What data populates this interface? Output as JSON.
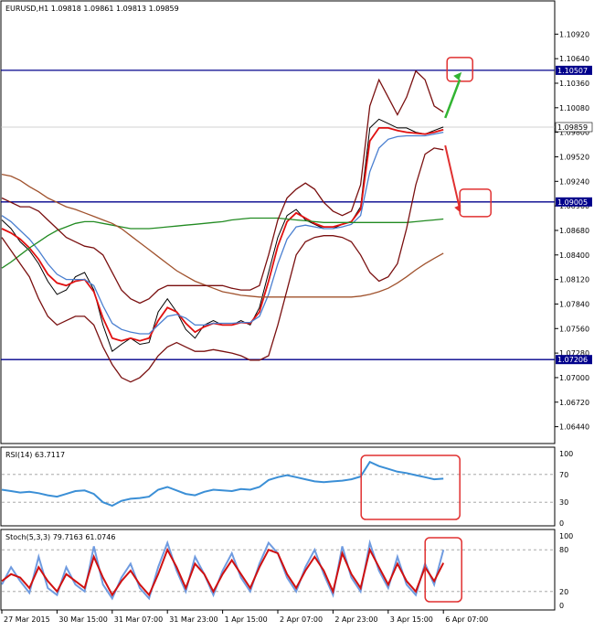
{
  "chart_data": [
    {
      "type": "line",
      "panel": "main",
      "header": "EURUSD,H1  1.09818 1.09861 1.09813 1.09859",
      "ylim": [
        1.063,
        1.1108
      ],
      "y_ticks": [
        "1.10920",
        "1.10640",
        "1.10360",
        "1.10080",
        "1.09800",
        "1.09520",
        "1.09240",
        "1.08960",
        "1.08680",
        "1.08400",
        "1.08120",
        "1.07840",
        "1.07560",
        "1.07280",
        "1.07000",
        "1.06720",
        "1.06440"
      ],
      "levels": [
        {
          "value": 1.10507,
          "label": "1.10507",
          "color": "#00008b"
        },
        {
          "value": 1.09005,
          "label": "1.09005",
          "color": "#00008b"
        },
        {
          "value": 1.07206,
          "label": "1.07206",
          "color": "#00008b"
        }
      ],
      "current_price": {
        "value": 1.09859,
        "label": "1.09859"
      },
      "x_points": [
        0,
        10,
        20,
        30,
        40,
        50,
        60,
        70,
        80,
        90,
        100,
        110,
        120,
        130,
        140,
        150,
        160,
        170,
        180,
        190,
        200,
        210,
        220,
        230,
        240,
        250,
        260,
        270,
        280,
        290,
        300,
        310,
        320,
        330,
        340,
        350,
        360,
        370,
        380,
        390,
        400,
        410,
        420,
        430,
        440,
        450,
        460,
        470,
        480
      ],
      "close": [
        1.088,
        1.087,
        1.0855,
        1.0845,
        1.083,
        1.081,
        1.0795,
        1.08,
        1.0815,
        1.082,
        1.08,
        1.076,
        1.073,
        1.0738,
        1.0745,
        1.0738,
        1.074,
        1.0775,
        1.079,
        1.0775,
        1.0755,
        1.0745,
        1.076,
        1.0765,
        1.076,
        1.076,
        1.0765,
        1.076,
        1.078,
        1.082,
        1.086,
        1.0885,
        1.0892,
        1.088,
        1.0875,
        1.087,
        1.087,
        1.0875,
        1.0878,
        1.0895,
        1.0985,
        1.0995,
        1.099,
        1.0985,
        1.0985,
        1.098,
        1.0978,
        1.0982,
        1.0986
      ],
      "series": [
        {
          "key": "ma_fast",
          "color": "#e01010",
          "values": [
            1.087,
            1.0865,
            1.0858,
            1.0848,
            1.0835,
            1.0818,
            1.0808,
            1.0805,
            1.081,
            1.0812,
            1.0798,
            1.0768,
            1.0745,
            1.0742,
            1.0745,
            1.0742,
            1.0745,
            1.0765,
            1.078,
            1.0775,
            1.0762,
            1.0752,
            1.0758,
            1.0762,
            1.076,
            1.076,
            1.0763,
            1.0762,
            1.0775,
            1.081,
            1.085,
            1.0878,
            1.0888,
            1.0882,
            1.0876,
            1.0872,
            1.0872,
            1.0875,
            1.0878,
            1.0892,
            1.097,
            1.0985,
            1.0985,
            1.0982,
            1.098,
            1.0979,
            1.0978,
            1.098,
            1.0983
          ]
        },
        {
          "key": "ma_mid",
          "color": "#4a7fd0",
          "values": [
            1.0885,
            1.0878,
            1.0868,
            1.0858,
            1.0845,
            1.083,
            1.0818,
            1.0812,
            1.0812,
            1.0812,
            1.0805,
            1.0782,
            1.0762,
            1.0755,
            1.0752,
            1.075,
            1.075,
            1.076,
            1.077,
            1.0772,
            1.0768,
            1.076,
            1.076,
            1.0762,
            1.0762,
            1.0762,
            1.0763,
            1.0763,
            1.077,
            1.0795,
            1.083,
            1.0858,
            1.0872,
            1.0874,
            1.0872,
            1.087,
            1.087,
            1.0872,
            1.0875,
            1.0885,
            1.0935,
            1.0962,
            1.0972,
            1.0975,
            1.0976,
            1.0976,
            1.0976,
            1.0978,
            1.098
          ]
        },
        {
          "key": "ma_200",
          "color": "#228b22",
          "values": [
            1.0825,
            1.0832,
            1.084,
            1.0848,
            1.0855,
            1.0862,
            1.0868,
            1.0872,
            1.0876,
            1.0878,
            1.0878,
            1.0876,
            1.0874,
            1.0872,
            1.087,
            1.087,
            1.087,
            1.0871,
            1.0872,
            1.0873,
            1.0874,
            1.0875,
            1.0876,
            1.0877,
            1.0878,
            1.088,
            1.0881,
            1.0882,
            1.0882,
            1.0882,
            1.0882,
            1.0881,
            1.088,
            1.0879,
            1.0878,
            1.0877,
            1.0877,
            1.0877,
            1.0877,
            1.0877,
            1.0877,
            1.0877,
            1.0877,
            1.0877,
            1.0877,
            1.0878,
            1.0879,
            1.088,
            1.0881
          ]
        },
        {
          "key": "ma_100",
          "color": "#a0522d",
          "values": [
            1.0932,
            1.093,
            1.0925,
            1.0918,
            1.0912,
            1.0905,
            1.09,
            1.0895,
            1.0892,
            1.0888,
            1.0884,
            1.088,
            1.0876,
            1.087,
            1.0862,
            1.0854,
            1.0846,
            1.0838,
            1.083,
            1.0822,
            1.0816,
            1.081,
            1.0806,
            1.0802,
            1.0798,
            1.0796,
            1.0794,
            1.0793,
            1.0792,
            1.0792,
            1.0792,
            1.0792,
            1.0792,
            1.0792,
            1.0792,
            1.0792,
            1.0792,
            1.0792,
            1.0792,
            1.0793,
            1.0795,
            1.0798,
            1.0802,
            1.0808,
            1.0815,
            1.0823,
            1.083,
            1.0836,
            1.0842
          ]
        },
        {
          "key": "bb_upper",
          "color": "#7a1010",
          "values": [
            1.0905,
            1.09,
            1.0895,
            1.0895,
            1.089,
            1.088,
            1.087,
            1.086,
            1.0855,
            1.085,
            1.0848,
            1.084,
            1.082,
            1.08,
            1.079,
            1.0785,
            1.079,
            1.08,
            1.0805,
            1.0805,
            1.0805,
            1.0805,
            1.0805,
            1.0805,
            1.0805,
            1.0802,
            1.08,
            1.08,
            1.0805,
            1.084,
            1.088,
            1.0905,
            1.0915,
            1.0922,
            1.0915,
            1.09,
            1.089,
            1.0885,
            1.089,
            1.092,
            1.101,
            1.104,
            1.102,
            1.1,
            1.102,
            1.105,
            1.104,
            1.101,
            1.1003
          ]
        },
        {
          "key": "bb_lower",
          "color": "#7a1010",
          "values": [
            1.086,
            1.0845,
            1.083,
            1.0815,
            1.079,
            1.077,
            1.076,
            1.0765,
            1.077,
            1.077,
            1.076,
            1.0735,
            1.0715,
            1.07,
            1.0695,
            1.07,
            1.071,
            1.0725,
            1.0735,
            1.074,
            1.0735,
            1.073,
            1.073,
            1.0732,
            1.073,
            1.0728,
            1.0725,
            1.072,
            1.072,
            1.0725,
            1.076,
            1.08,
            1.084,
            1.0855,
            1.086,
            1.0862,
            1.0862,
            1.086,
            1.0855,
            1.084,
            1.082,
            1.081,
            1.0815,
            1.083,
            1.087,
            1.092,
            1.0955,
            1.0962,
            1.096
          ]
        }
      ],
      "annotations": [
        {
          "type": "arrow",
          "color": "#32b432",
          "direction": "up"
        },
        {
          "type": "arrow",
          "color": "#e03030",
          "direction": "down"
        },
        {
          "type": "box",
          "color": "#e03030",
          "at": "upper-right"
        },
        {
          "type": "box",
          "color": "#e03030",
          "at": "lower-right"
        }
      ]
    },
    {
      "type": "line",
      "panel": "rsi",
      "header": "RSI(14) 63.7117",
      "ylim": [
        0,
        100
      ],
      "y_ticks": [
        "100",
        "70",
        "30",
        "0"
      ],
      "levels": [
        70,
        30
      ],
      "series": [
        {
          "key": "rsi",
          "color": "#3b8fd6",
          "values": [
            48,
            46,
            44,
            45,
            43,
            40,
            38,
            42,
            46,
            47,
            42,
            30,
            25,
            32,
            35,
            36,
            38,
            48,
            52,
            47,
            42,
            40,
            45,
            48,
            47,
            46,
            49,
            48,
            52,
            62,
            66,
            69,
            66,
            63,
            60,
            59,
            60,
            61,
            63,
            67,
            88,
            82,
            78,
            74,
            72,
            69,
            66,
            63,
            64
          ]
        }
      ],
      "annotations": [
        {
          "type": "box",
          "color": "#e03030",
          "at": "right"
        }
      ]
    },
    {
      "type": "line",
      "panel": "stoch",
      "header": "Stoch(5,3,3) 79.7163 61.0746",
      "ylim": [
        0,
        100
      ],
      "y_ticks": [
        "100",
        "80",
        "20",
        "0"
      ],
      "levels": [
        80,
        20
      ],
      "series": [
        {
          "key": "k",
          "color": "#6f9be0",
          "values": [
            30,
            55,
            35,
            18,
            70,
            25,
            15,
            55,
            30,
            20,
            85,
            30,
            10,
            40,
            60,
            25,
            10,
            55,
            90,
            50,
            20,
            70,
            45,
            15,
            50,
            75,
            40,
            20,
            60,
            90,
            75,
            40,
            20,
            55,
            80,
            45,
            15,
            85,
            40,
            20,
            90,
            50,
            25,
            70,
            30,
            15,
            60,
            30,
            80
          ]
        },
        {
          "key": "d",
          "color": "#d01010",
          "values": [
            35,
            45,
            40,
            25,
            55,
            35,
            20,
            45,
            35,
            25,
            70,
            40,
            15,
            35,
            50,
            30,
            15,
            45,
            80,
            55,
            25,
            60,
            45,
            20,
            45,
            65,
            45,
            25,
            55,
            80,
            75,
            45,
            25,
            50,
            70,
            50,
            20,
            75,
            45,
            25,
            80,
            55,
            30,
            60,
            35,
            20,
            55,
            35,
            61
          ]
        }
      ],
      "annotations": [
        {
          "type": "box",
          "color": "#e03030",
          "at": "right"
        }
      ]
    }
  ],
  "x_ticks": [
    "27 Mar 2015",
    "30 Mar 15:00",
    "31 Mar 07:00",
    "31 Mar 23:00",
    "1 Apr 15:00",
    "2 Apr 07:00",
    "2 Apr 23:00",
    "3 Apr 15:00",
    "6 Apr 07:00"
  ],
  "x_tick_points": [
    0,
    60,
    120,
    180,
    240,
    300,
    360,
    420,
    480
  ]
}
